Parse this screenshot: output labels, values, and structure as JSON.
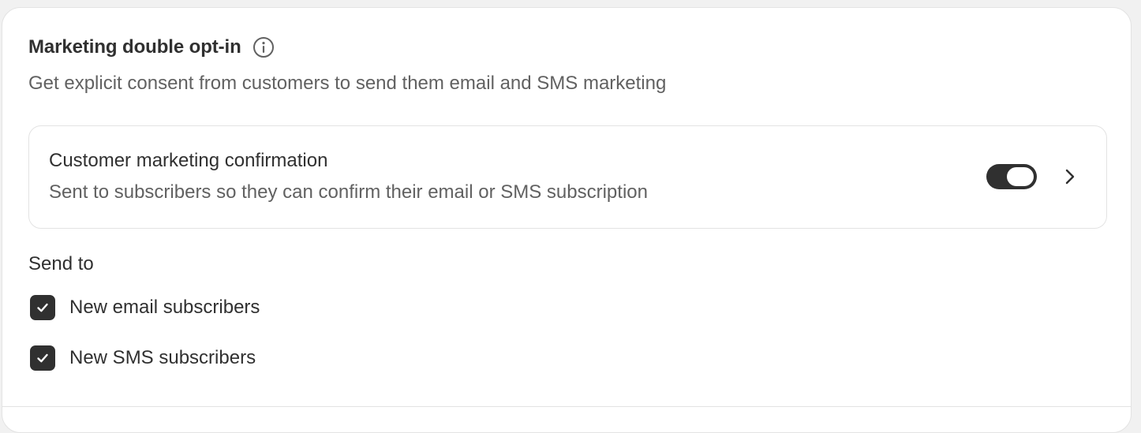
{
  "section": {
    "title": "Marketing double opt-in",
    "info_icon": "info-icon",
    "subtitle": "Get explicit consent from customers to send them email and SMS marketing"
  },
  "notification": {
    "title": "Customer marketing confirmation",
    "description": "Sent to subscribers so they can confirm their email or SMS subscription",
    "toggle_on": true,
    "chevron_icon": "chevron-right-icon"
  },
  "send_to": {
    "label": "Send to",
    "options": [
      {
        "label": "New email subscribers",
        "checked": true
      },
      {
        "label": "New SMS subscribers",
        "checked": true
      }
    ]
  },
  "colors": {
    "text_primary": "#303030",
    "text_secondary": "#616161",
    "border": "#e3e3e3",
    "control_fill": "#303030"
  }
}
